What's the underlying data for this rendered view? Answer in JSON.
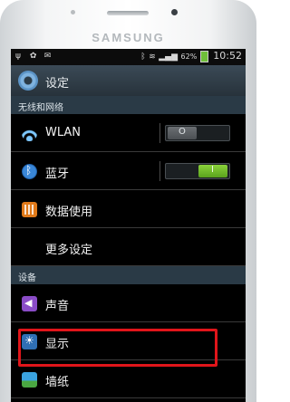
{
  "device": {
    "brand": "SAMSUNG"
  },
  "status_bar": {
    "battery": "62%",
    "time": "10:52"
  },
  "header": {
    "title": "设定"
  },
  "sections": {
    "network": "无线和网络",
    "device": "设备"
  },
  "items": {
    "wlan": {
      "label": "WLAN",
      "toggle_state": "O"
    },
    "bluetooth": {
      "label": "蓝牙",
      "toggle_state": "I"
    },
    "data_usage": {
      "label": "数据使用"
    },
    "more_settings": {
      "label": "更多设定"
    },
    "sound": {
      "label": "声音"
    },
    "display": {
      "label": "显示"
    },
    "wallpaper": {
      "label": "墙纸"
    }
  },
  "colors": {
    "highlight": "#e0151a",
    "toggle_on": "#6fbf2a",
    "header_bg": "#2a3a46"
  }
}
